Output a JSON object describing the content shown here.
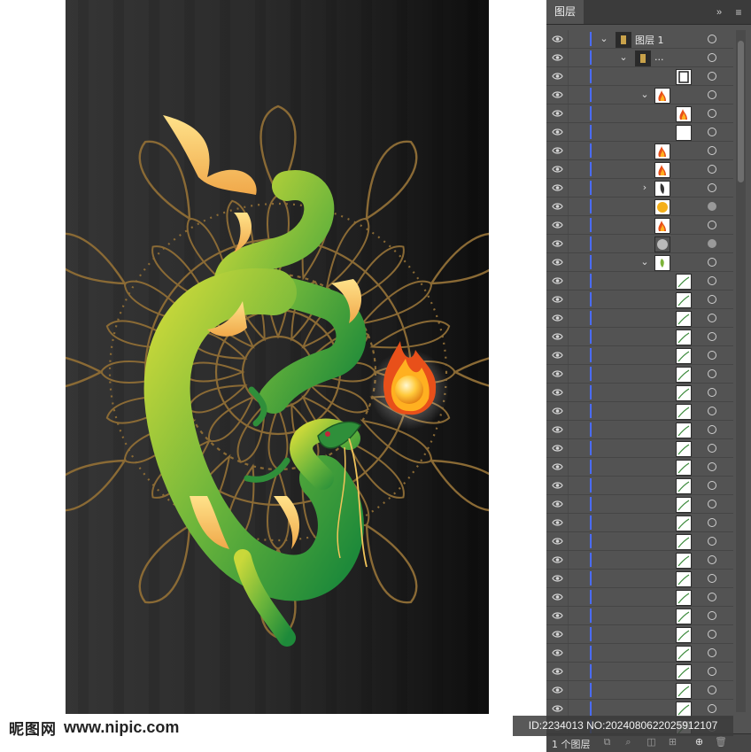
{
  "panel": {
    "tab_label": "图层",
    "collapse_icon": "double-chevron-right-icon",
    "menu_icon": "hamburger-menu-icon",
    "footer_count": "1 个图层"
  },
  "layers": [
    {
      "name": "图层 1",
      "depth": 0,
      "chevron": "down",
      "thumb": "art",
      "target": "hollow"
    },
    {
      "name": "...",
      "depth": 1,
      "chevron": "down",
      "thumb": "art",
      "target": "hollow"
    },
    {
      "name": "",
      "depth": 3,
      "chevron": "none",
      "thumb": "frame",
      "target": "hollow"
    },
    {
      "name": "",
      "depth": 2,
      "chevron": "down",
      "thumb": "flame",
      "target": "hollow"
    },
    {
      "name": "",
      "depth": 3,
      "chevron": "none",
      "thumb": "flame",
      "target": "hollow"
    },
    {
      "name": "",
      "depth": 3,
      "chevron": "none",
      "thumb": "blank",
      "target": "hollow"
    },
    {
      "name": "",
      "depth": 2,
      "chevron": "none",
      "thumb": "flame",
      "target": "hollow"
    },
    {
      "name": "",
      "depth": 2,
      "chevron": "none",
      "thumb": "flame",
      "target": "hollow"
    },
    {
      "name": "",
      "depth": 2,
      "chevron": "right",
      "thumb": "dark",
      "target": "hollow"
    },
    {
      "name": "",
      "depth": 2,
      "chevron": "none",
      "thumb": "orb",
      "target": "filled"
    },
    {
      "name": "",
      "depth": 2,
      "chevron": "none",
      "thumb": "flame",
      "target": "hollow"
    },
    {
      "name": "",
      "depth": 2,
      "chevron": "none",
      "thumb": "sphere",
      "target": "filled"
    },
    {
      "name": "",
      "depth": 2,
      "chevron": "down",
      "thumb": "dragon",
      "target": "hollow"
    },
    {
      "name": "",
      "depth": 3,
      "chevron": "none",
      "thumb": "stroke",
      "target": "hollow"
    },
    {
      "name": "",
      "depth": 3,
      "chevron": "none",
      "thumb": "stroke",
      "target": "hollow"
    },
    {
      "name": "",
      "depth": 3,
      "chevron": "none",
      "thumb": "stroke",
      "target": "hollow"
    },
    {
      "name": "",
      "depth": 3,
      "chevron": "none",
      "thumb": "stroke",
      "target": "hollow"
    },
    {
      "name": "",
      "depth": 3,
      "chevron": "none",
      "thumb": "stroke",
      "target": "hollow"
    },
    {
      "name": "",
      "depth": 3,
      "chevron": "none",
      "thumb": "stroke",
      "target": "hollow"
    },
    {
      "name": "",
      "depth": 3,
      "chevron": "none",
      "thumb": "stroke",
      "target": "hollow"
    },
    {
      "name": "",
      "depth": 3,
      "chevron": "none",
      "thumb": "stroke",
      "target": "hollow"
    },
    {
      "name": "",
      "depth": 3,
      "chevron": "none",
      "thumb": "stroke",
      "target": "hollow"
    },
    {
      "name": "",
      "depth": 3,
      "chevron": "none",
      "thumb": "stroke",
      "target": "hollow"
    },
    {
      "name": "",
      "depth": 3,
      "chevron": "none",
      "thumb": "stroke",
      "target": "hollow"
    },
    {
      "name": "",
      "depth": 3,
      "chevron": "none",
      "thumb": "stroke",
      "target": "hollow"
    },
    {
      "name": "",
      "depth": 3,
      "chevron": "none",
      "thumb": "stroke",
      "target": "hollow"
    },
    {
      "name": "",
      "depth": 3,
      "chevron": "none",
      "thumb": "stroke",
      "target": "hollow"
    },
    {
      "name": "",
      "depth": 3,
      "chevron": "none",
      "thumb": "stroke",
      "target": "hollow"
    },
    {
      "name": "",
      "depth": 3,
      "chevron": "none",
      "thumb": "stroke",
      "target": "hollow"
    },
    {
      "name": "",
      "depth": 3,
      "chevron": "none",
      "thumb": "stroke",
      "target": "hollow"
    },
    {
      "name": "",
      "depth": 3,
      "chevron": "none",
      "thumb": "stroke",
      "target": "hollow"
    },
    {
      "name": "",
      "depth": 3,
      "chevron": "none",
      "thumb": "stroke",
      "target": "hollow"
    },
    {
      "name": "",
      "depth": 3,
      "chevron": "none",
      "thumb": "stroke",
      "target": "hollow"
    },
    {
      "name": "",
      "depth": 3,
      "chevron": "none",
      "thumb": "stroke",
      "target": "hollow"
    },
    {
      "name": "",
      "depth": 3,
      "chevron": "none",
      "thumb": "stroke",
      "target": "hollow"
    },
    {
      "name": "",
      "depth": 3,
      "chevron": "none",
      "thumb": "stroke",
      "target": "hollow"
    },
    {
      "name": "",
      "depth": 3,
      "chevron": "none",
      "thumb": "stroke",
      "target": "hollow"
    },
    {
      "name": "",
      "depth": 3,
      "chevron": "none",
      "thumb": "stroke",
      "target": "hollow"
    },
    {
      "name": "",
      "depth": 3,
      "chevron": "none",
      "thumb": "stroke",
      "target": "hollow"
    }
  ],
  "watermark": {
    "logo_text": "昵图网",
    "url_text": "www.nipic.com",
    "id_text": "ID:2234013 NO:20240806220259121​07"
  },
  "colors": {
    "panel_bg": "#535353",
    "selection_bar": "#4a6cff",
    "dragon_green": "#3fa63a",
    "dragon_gold": "#f2c45a",
    "mandala_gold": "#8a6a35"
  }
}
